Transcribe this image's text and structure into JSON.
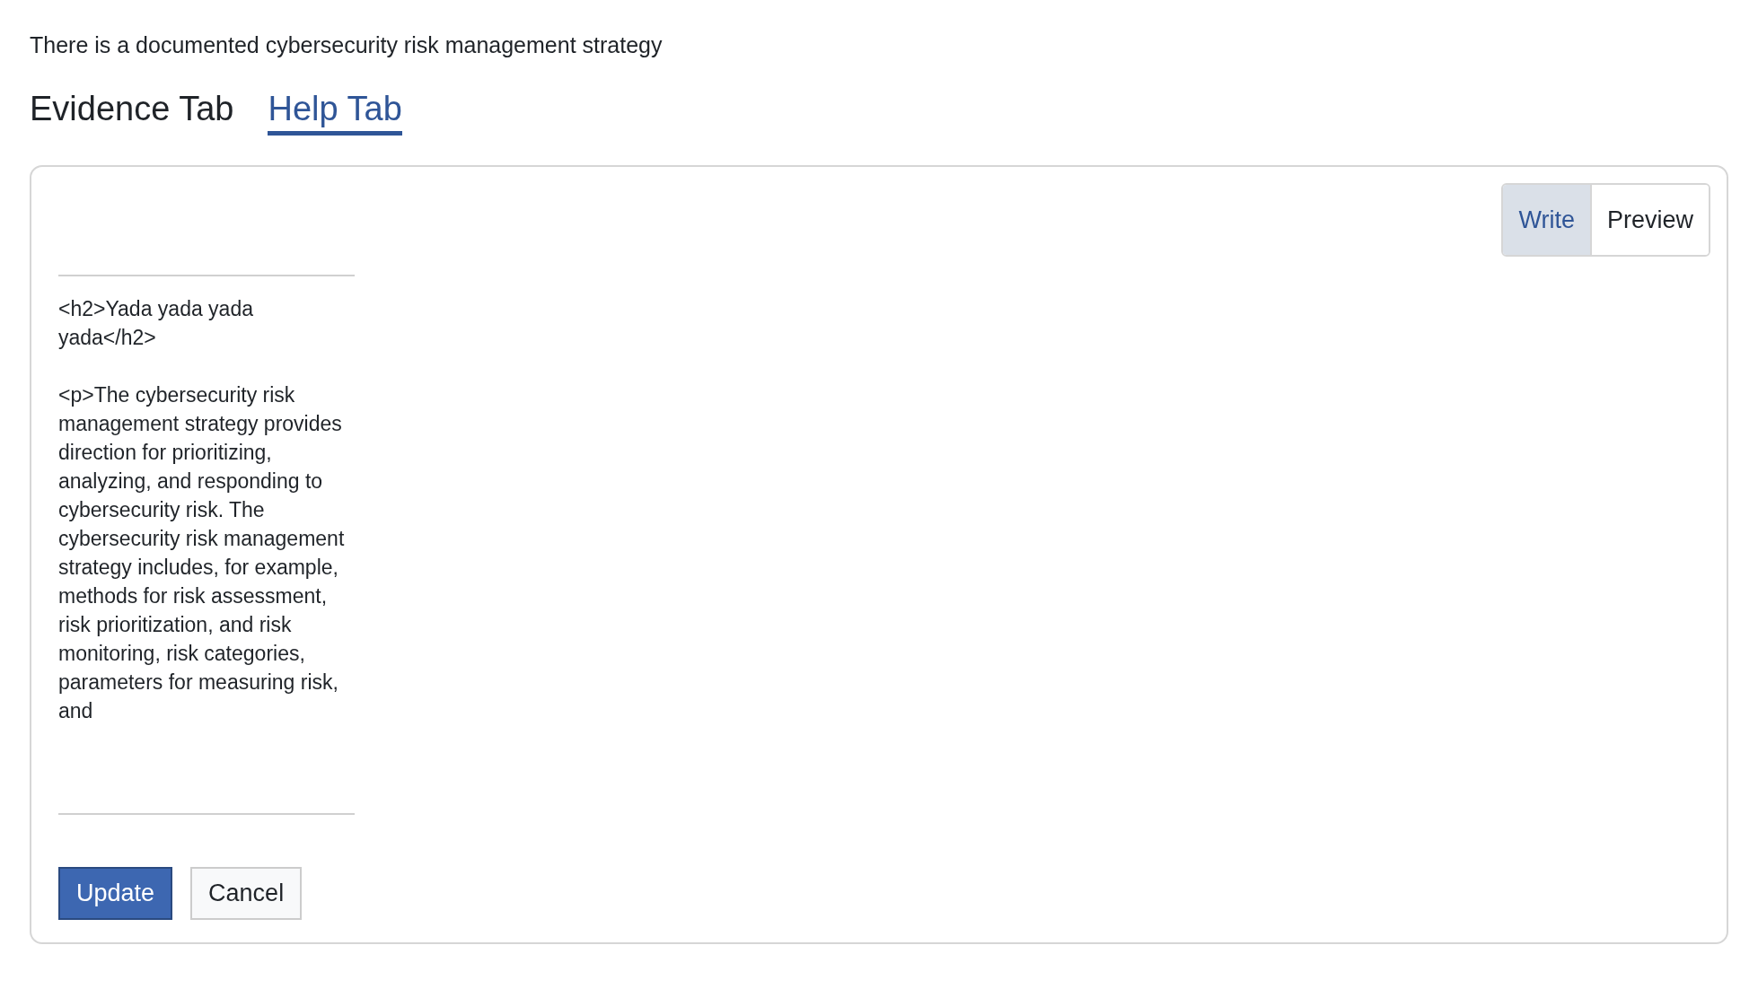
{
  "question": "There is a documented cybersecurity risk management strategy",
  "tabs": [
    {
      "label": "Evidence Tab",
      "selected": false
    },
    {
      "label": "Help Tab",
      "selected": true
    }
  ],
  "editor": {
    "modes": [
      {
        "label": "Write",
        "selected": true
      },
      {
        "label": "Preview",
        "selected": false
      }
    ],
    "value": "<h2>Yada yada yada yada</h2>\n\n<p>The cybersecurity risk management strategy provides direction for prioritizing, analyzing, and responding to cybersecurity risk. The cybersecurity risk management strategy includes, for example, methods for risk assessment, risk prioritization, and risk monitoring, risk categories, parameters for measuring risk, and"
  },
  "buttons": [
    {
      "label": "Update",
      "kind": "primary"
    },
    {
      "label": "Cancel",
      "kind": "secondary"
    }
  ]
}
